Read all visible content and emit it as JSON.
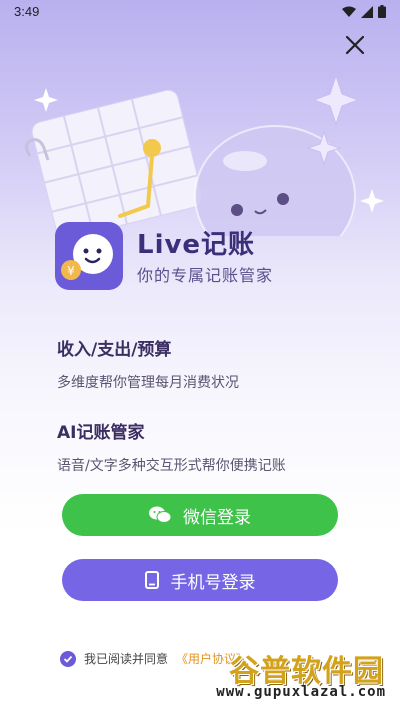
{
  "status_bar": {
    "time": "3:49"
  },
  "brand": {
    "name": "Live记账",
    "tagline": "你的专属记账管家"
  },
  "features": [
    {
      "title": "收入/支出/预算",
      "desc": "多维度帮你管理每月消费状况"
    },
    {
      "title": "AI记账管家",
      "desc": "语音/文字多种交互形式帮你便携记账"
    }
  ],
  "buttons": {
    "wechat_login": "微信登录",
    "phone_login": "手机号登录"
  },
  "agreement": {
    "text": "我已阅读并同意",
    "link": "《用户协议》",
    "checked": true
  },
  "watermark": {
    "title": "谷普软件园",
    "url": "www.gupuxlazal.com"
  },
  "colors": {
    "accent": "#6b5bd8",
    "wechat": "#3ec24a",
    "phone_button": "#7666e6",
    "link": "#e0931f"
  }
}
